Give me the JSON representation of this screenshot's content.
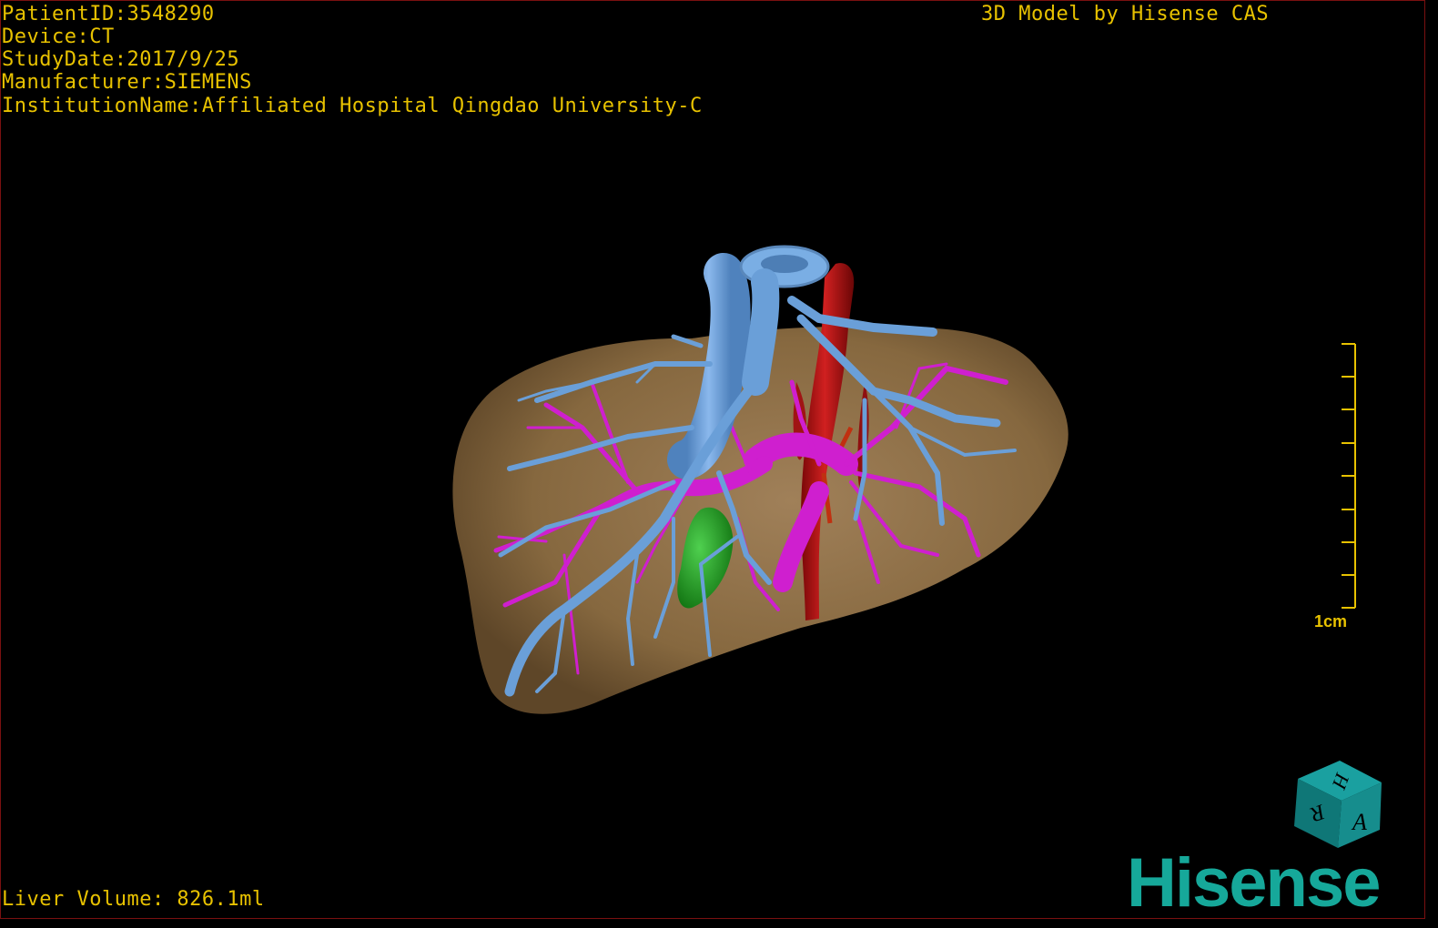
{
  "patient_info": {
    "patient_id": "PatientID:3548290",
    "device": "Device:CT",
    "study_date": "StudyDate:2017/9/25",
    "manufacturer": "Manufacturer:SIEMENS",
    "institution": "InstitutionName:Affiliated Hospital Qingdao University-C"
  },
  "header_right": "3D Model by Hisense CAS",
  "footer": {
    "liver_volume": "Liver Volume: 826.1ml"
  },
  "scale_bar": {
    "label": "1cm"
  },
  "orientation_cube": {
    "top_face": "H",
    "left_face": "R",
    "right_face": "A"
  },
  "brand": {
    "logo_text": "Hisense"
  },
  "colors": {
    "overlay_text": "#e8c200",
    "liver": "#8b6b45",
    "hepatic_vein": "#6a9fd8",
    "portal_vein": "#d020d0",
    "artery": "#b01010",
    "gallbladder": "#1ea01e",
    "cube": "#168d8d",
    "brand": "#16a89a"
  }
}
